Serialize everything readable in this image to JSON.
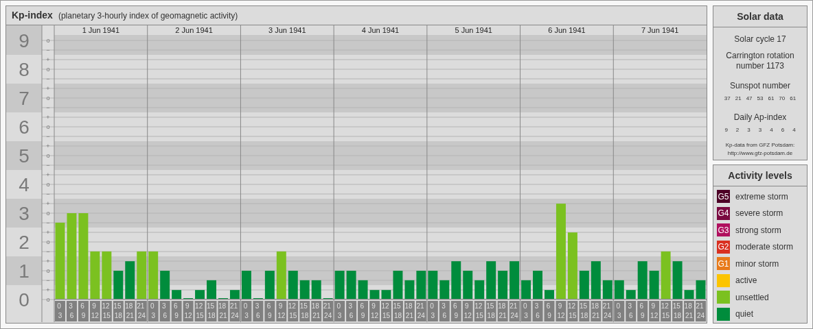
{
  "kp_panel": {
    "title": "Kp-index",
    "subtitle": "(planetary 3-hourly index of geomagnetic activity)",
    "day_labels": [
      "1 Jun 1941",
      "2 Jun 1941",
      "3 Jun 1941",
      "4 Jun 1941",
      "5 Jun 1941",
      "6 Jun 1941",
      "7 Jun 1941"
    ],
    "sub_marks": [
      "o",
      "−",
      "+",
      "o",
      "−",
      "+",
      "o",
      "−",
      "+",
      "o",
      "−",
      "+",
      "o",
      "−",
      "+",
      "o",
      "−",
      "+",
      "o",
      "−",
      "+",
      "o",
      "−",
      "+",
      "o",
      "−",
      "+",
      "o"
    ],
    "chart_data": {
      "type": "bar",
      "grid": true,
      "ylim": [
        0,
        9
      ],
      "yticks": [
        0,
        1,
        2,
        3,
        4,
        5,
        6,
        7,
        8,
        9
      ],
      "categories": [
        "0 3",
        "3 6",
        "6 9",
        "9 12",
        "12 15",
        "15 18",
        "18 21",
        "21 24",
        "0 3",
        "3 6",
        "6 9",
        "9 12",
        "12 15",
        "15 18",
        "18 21",
        "21 24",
        "0 3",
        "3 6",
        "6 9",
        "9 12",
        "12 15",
        "15 18",
        "18 21",
        "21 24",
        "0 3",
        "3 6",
        "6 9",
        "9 12",
        "12 15",
        "15 18",
        "18 21",
        "21 24",
        "0 3",
        "3 6",
        "6 9",
        "9 12",
        "12 15",
        "15 18",
        "18 21",
        "21 24",
        "0 3",
        "3 6",
        "6 9",
        "9 12",
        "12 15",
        "15 18",
        "18 21",
        "21 24",
        "0 3",
        "3 6",
        "6 9",
        "9 12",
        "12 15",
        "15 18",
        "18 21",
        "21 24"
      ],
      "values": [
        2.67,
        3,
        3,
        1.67,
        1.67,
        1,
        1.33,
        1.67,
        1.67,
        1,
        0.33,
        0,
        0.33,
        0.67,
        0,
        0.33,
        1,
        0,
        1,
        1.67,
        1,
        0.67,
        0.67,
        0,
        1,
        1,
        0.67,
        0.33,
        0.33,
        1,
        0.67,
        1,
        1,
        0.67,
        1.33,
        1,
        0.67,
        1.33,
        1,
        1.33,
        0.67,
        1,
        0.33,
        3.33,
        2.33,
        1,
        1.33,
        0.67,
        0.67,
        0.33,
        1.33,
        1,
        1.67,
        1.33,
        0.33,
        0.67
      ]
    }
  },
  "solar_data": {
    "title": "Solar data",
    "cycle": "Solar cycle 17",
    "carrington": "Carrington rotation number 1173",
    "sunspot_title": "Sunspot number",
    "sunspots": [
      "37",
      "21",
      "47",
      "53",
      "61",
      "70",
      "61"
    ],
    "ap_title": "Daily Ap-index",
    "ap": [
      "9",
      "2",
      "3",
      "3",
      "4",
      "6",
      "4"
    ],
    "source": "Kp-data from GFZ Potsdam:",
    "source_url": "http://www.gfz-potsdam.de"
  },
  "activity_levels": {
    "title": "Activity levels",
    "items": [
      {
        "badge": "G5",
        "label": "extreme storm",
        "color": "#4d0026"
      },
      {
        "badge": "G4",
        "label": "severe storm",
        "color": "#7a0a40"
      },
      {
        "badge": "G3",
        "label": "strong storm",
        "color": "#b0105e"
      },
      {
        "badge": "G2",
        "label": "moderate storm",
        "color": "#d93020"
      },
      {
        "badge": "G1",
        "label": "minor storm",
        "color": "#e87a1a"
      },
      {
        "label": "active",
        "color": "#fcc400"
      },
      {
        "label": "unsettled",
        "color": "#7bc120"
      },
      {
        "label": "quiet",
        "color": "#008c3c"
      }
    ]
  }
}
